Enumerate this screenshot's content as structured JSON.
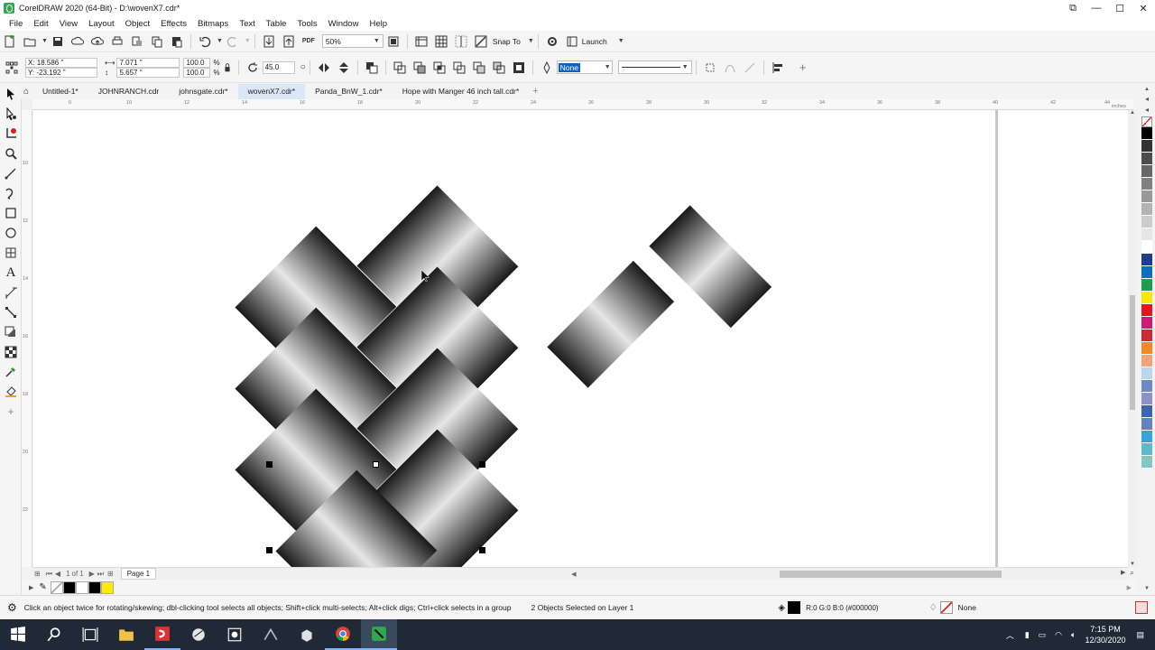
{
  "window": {
    "title": "CorelDRAW 2020 (64-Bit) - D:\\wovenX7.cdr*",
    "buttons": [
      "⧉",
      "—",
      "☐",
      "✕"
    ]
  },
  "menu": [
    "File",
    "Edit",
    "View",
    "Layout",
    "Object",
    "Effects",
    "Bitmaps",
    "Text",
    "Table",
    "Tools",
    "Window",
    "Help"
  ],
  "toolbar1": {
    "zoom": "50%",
    "snap_to": "Snap To",
    "launch": "Launch"
  },
  "propbar": {
    "x": "X: 18.586 \"",
    "y": "Y: -23.192 \"",
    "width": "7.071 \"",
    "height": "5.657 \"",
    "scale_w": "100.0",
    "scale_h": "100.0",
    "pct": "%",
    "angle": "45.0",
    "outline": "None"
  },
  "tabs": [
    "Untitled-1*",
    "JOHNRANCH.cdr",
    "johnsgate.cdr*",
    "wovenX7.cdr*",
    "Panda_BnW_1.cdr*",
    "Hope with Manger 46 inch tall.cdr*"
  ],
  "active_tab": "wovenX7.cdr*",
  "ruler": {
    "h_labels": [
      "0",
      "10",
      "12",
      "14",
      "16",
      "18",
      "20",
      "22",
      "24",
      "26",
      "28",
      "30",
      "32",
      "34",
      "36",
      "38",
      "40",
      "42",
      "44"
    ],
    "unit": "inches",
    "v_labels": [
      "10",
      "12",
      "14",
      "16",
      "18",
      "20",
      "22",
      "24",
      "26"
    ]
  },
  "page_nav": {
    "of": "1",
    "page": "1",
    "page_tab": "Page 1"
  },
  "status": {
    "hint": "Click an object twice for rotating/skewing; dbl-clicking tool selects all objects; Shift+click multi-selects; Alt+click digs; Ctrl+click selects in a group",
    "selection": "2 Objects Selected on Layer 1",
    "fill": "R:0 G:0 B:0 (#000000)",
    "outline": "None"
  },
  "taskbar": {
    "time": "7:15 PM",
    "date": "12/30/2020"
  },
  "palette_colors": [
    "#000000",
    "#333333",
    "#4d4d4d",
    "#666666",
    "#808080",
    "#999999",
    "#b3b3b3",
    "#cccccc",
    "#e6e6e6",
    "#ffffff",
    "#1f3c8f",
    "#0b6fc1",
    "#1e9e4b",
    "#f7e800",
    "#e7141c",
    "#d1197a",
    "#cc2a35",
    "#f08a1c",
    "#f2a57a",
    "#b9d7ee",
    "#6d88c5",
    "#8a92c7",
    "#3d64b1",
    "#5e84c7",
    "#35a4da",
    "#5bbcc9",
    "#82c8c1"
  ],
  "doc_swatches": [
    "#ffffff",
    "#000000",
    "#ffffff",
    "#000000",
    "#ffea00"
  ]
}
